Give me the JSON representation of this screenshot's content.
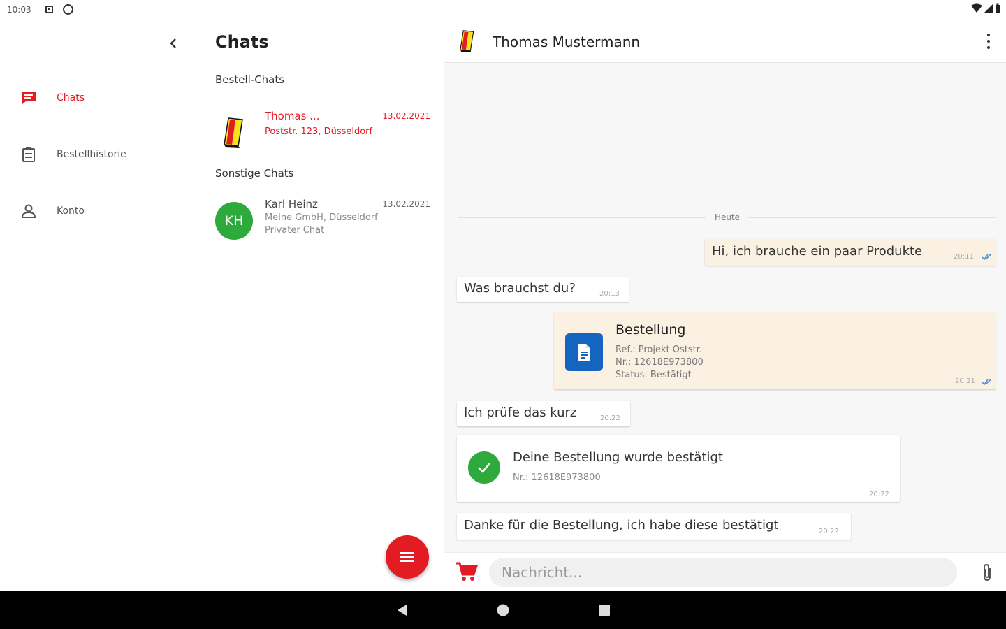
{
  "status_bar": {
    "time": "10:03"
  },
  "nav": {
    "items": [
      {
        "label": "Chats",
        "icon": "chat-icon",
        "active": true
      },
      {
        "label": "Bestellhistorie",
        "icon": "clipboard-icon",
        "active": false
      },
      {
        "label": "Konto",
        "icon": "person-icon",
        "active": false
      }
    ]
  },
  "chats": {
    "title": "Chats",
    "order_section": "Bestell-Chats",
    "other_section": "Sonstige Chats",
    "order_chats": [
      {
        "name": "Thomas ...",
        "date": "13.02.2021",
        "address": "Poststr. 123, Düsseldorf"
      }
    ],
    "other_chats": [
      {
        "initials": "KH",
        "name": "Karl Heinz",
        "date": "13.02.2021",
        "company": "Meine GmbH, Düsseldorf",
        "type": "Privater Chat"
      }
    ]
  },
  "conversation": {
    "contact_name": "Thomas Mustermann",
    "day_label": "Heute",
    "messages": [
      {
        "text": "Hi, ich brauche ein paar Produkte",
        "time": "20:11",
        "mine": true
      },
      {
        "text": "Was brauchst du?",
        "time": "20:13",
        "mine": false
      },
      {
        "order_title": "Bestellung",
        "ref": "Ref.: Projekt Oststr.",
        "nr": "Nr.: 12618E973800",
        "status": "Status: Bestätigt",
        "time": "20:21",
        "mine": true
      },
      {
        "text": "Ich prüfe das kurz",
        "time": "20:22",
        "mine": false
      },
      {
        "confirm_title": "Deine Bestellung wurde bestätigt",
        "nr": "Nr.: 12618E973800",
        "time": "20:22",
        "mine": false
      },
      {
        "text": "Danke für die Bestellung, ich habe diese bestätigt",
        "time": "20:22",
        "mine": false
      }
    ],
    "input_placeholder": "Nachricht..."
  },
  "colors": {
    "accent": "#e31b23",
    "avatar_green": "#2eaa3d",
    "order_blue": "#1565c0",
    "mine_bubble": "#fbf1e3",
    "read_check": "#4a90d9"
  }
}
